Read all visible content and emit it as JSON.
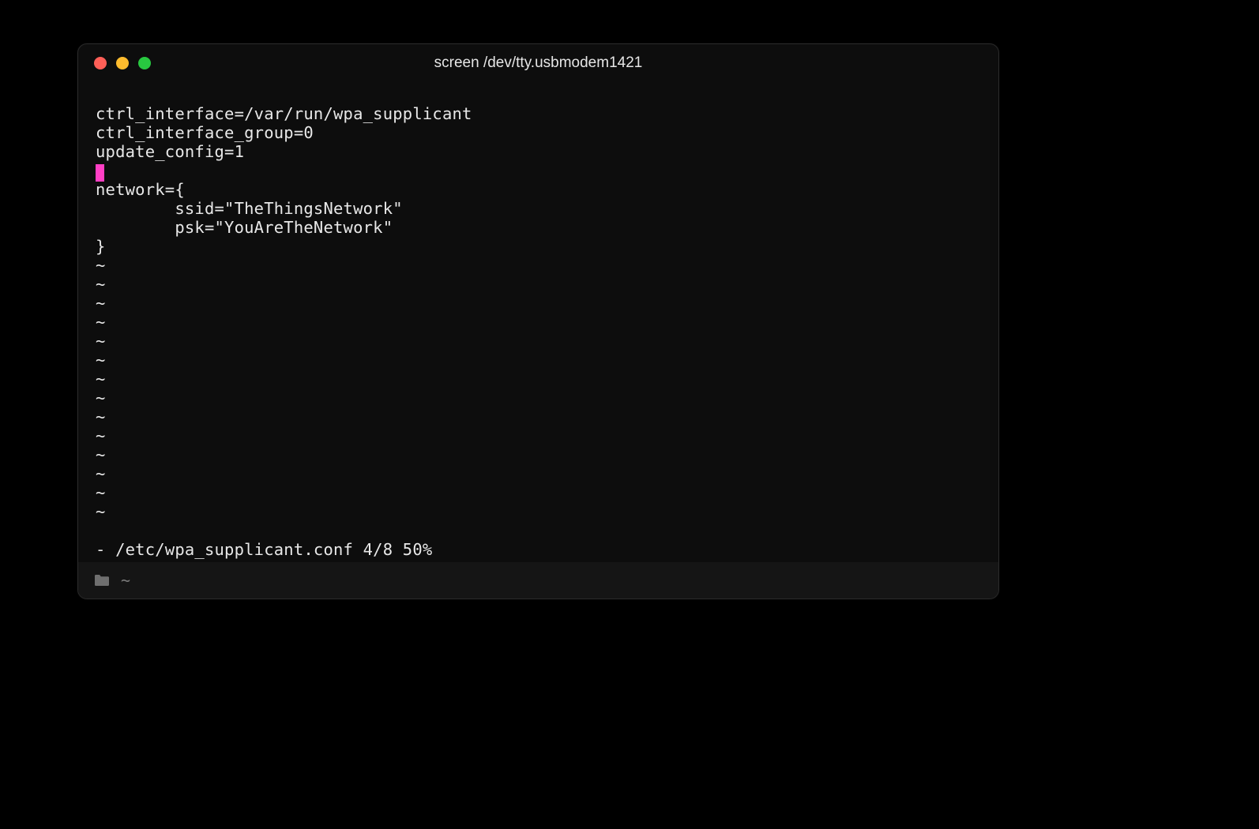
{
  "window": {
    "title": "screen /dev/tty.usbmodem1421"
  },
  "editor": {
    "lines": [
      "ctrl_interface=/var/run/wpa_supplicant",
      "ctrl_interface_group=0",
      "update_config=1"
    ],
    "lines_after_cursor": [
      "network={",
      "        ssid=\"TheThingsNetwork\"",
      "        psk=\"YouAreTheNetwork\"",
      "}"
    ],
    "filler_char": "~",
    "filler_count": 14,
    "status_line": "- /etc/wpa_supplicant.conf 4/8 50%"
  },
  "statusbar": {
    "path": "~"
  },
  "colors": {
    "cursor": "#ff3fc4",
    "traffic_red": "#ff5f57",
    "traffic_yellow": "#febc2e",
    "traffic_green": "#28c840"
  }
}
